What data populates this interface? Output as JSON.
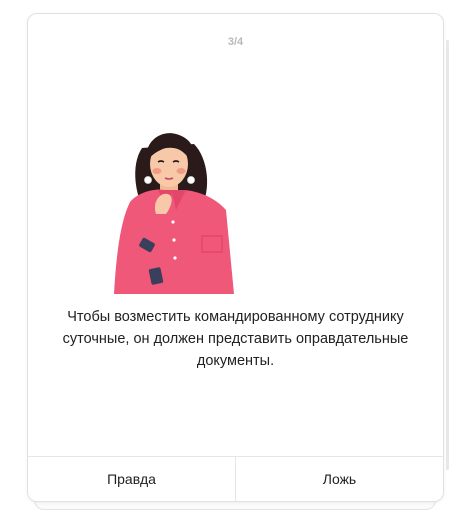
{
  "quiz": {
    "counter": "3/4",
    "question": "Чтобы возместить командированному сотруднику суточные, он должен представить оправдательные документы.",
    "answers": {
      "true_label": "Правда",
      "false_label": "Ложь"
    }
  },
  "colors": {
    "shirt": "#f0587a",
    "hair": "#2a1a1a",
    "skin": "#f7c9a8",
    "sleeve": "#3a3f5c"
  },
  "icons": {
    "illustration": "thinking-woman-illustration"
  }
}
